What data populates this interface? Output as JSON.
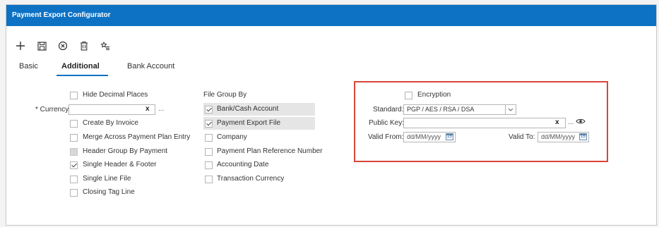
{
  "window": {
    "title": "Payment Export Configurator"
  },
  "toolbar": {
    "icons": [
      "add-icon",
      "save-icon",
      "cancel-icon",
      "delete-icon",
      "favorite-icon"
    ]
  },
  "tabs": [
    {
      "label": "Basic"
    },
    {
      "label": "Additional"
    },
    {
      "label": "Bank Account"
    }
  ],
  "left": {
    "hide_decimal": "Hide Decimal Places",
    "currency_label": "* Currency:",
    "currency_value": "",
    "currency_clear": "x",
    "currency_more": "...",
    "create_by_invoice": "Create By Invoice",
    "merge_across": "Merge Across Payment Plan Entry",
    "header_group": "Header Group By Payment",
    "single_header_footer": "Single Header & Footer",
    "single_line_file": "Single Line File",
    "closing_tag_line": "Closing Tag Line"
  },
  "file_group": {
    "heading": "File Group By",
    "items": [
      {
        "label": "Bank/Cash Account",
        "checked": true
      },
      {
        "label": "Payment Export File",
        "checked": true
      },
      {
        "label": "Company",
        "checked": false
      },
      {
        "label": "Payment Plan Reference Number",
        "checked": false
      },
      {
        "label": "Accounting Date",
        "checked": false
      },
      {
        "label": "Transaction Currency",
        "checked": false
      }
    ]
  },
  "encryption": {
    "encryption_label": "Encryption",
    "standard_label": "Standard:",
    "standard_value": "PGP / AES / RSA / DSA",
    "public_key_label": "Public Key:",
    "public_key_value": "",
    "public_key_clear": "x",
    "public_key_more": "...",
    "valid_from_label": "Valid From:",
    "valid_from_placeholder": "dd/MM/yyyy",
    "valid_to_label": "Valid To:",
    "valid_to_placeholder": "dd/MM/yyyy"
  },
  "colors": {
    "accent": "#0e72c4",
    "highlight_box": "#d9453b"
  }
}
